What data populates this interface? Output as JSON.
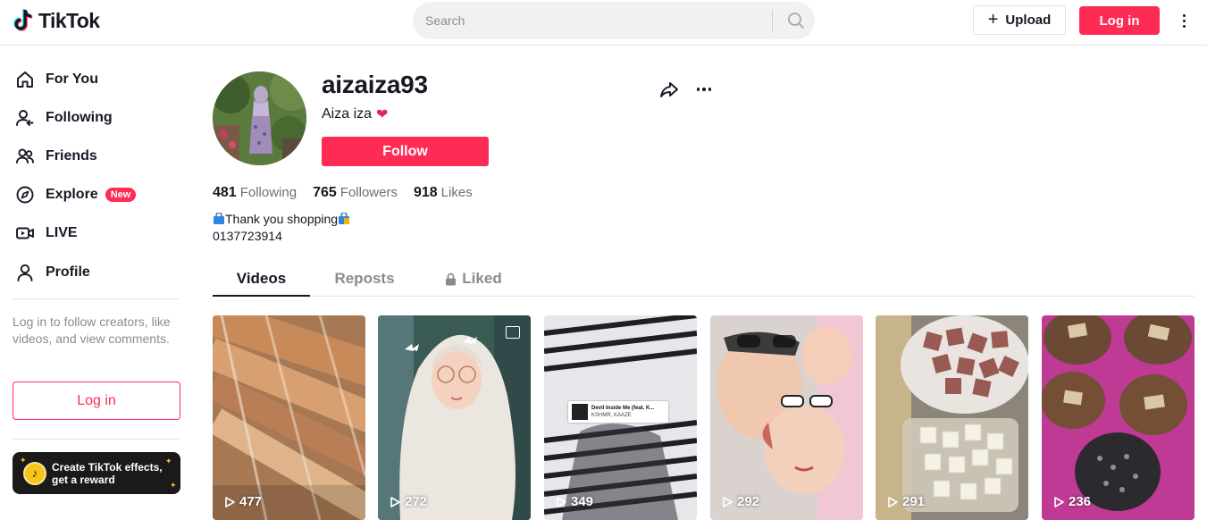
{
  "header": {
    "logo_text": "TikTok",
    "search_placeholder": "Search",
    "upload_label": "Upload",
    "login_label": "Log in"
  },
  "sidebar": {
    "items": [
      {
        "label": "For You",
        "icon": "home-icon"
      },
      {
        "label": "Following",
        "icon": "following-icon"
      },
      {
        "label": "Friends",
        "icon": "friends-icon"
      },
      {
        "label": "Explore",
        "icon": "compass-icon",
        "badge": "New"
      },
      {
        "label": "LIVE",
        "icon": "live-icon"
      },
      {
        "label": "Profile",
        "icon": "profile-icon"
      }
    ],
    "login_hint": "Log in to follow creators, like videos, and view comments.",
    "login_label": "Log in",
    "effects_banner": {
      "line1": "Create TikTok effects,",
      "line2": "get a reward"
    }
  },
  "profile": {
    "username": "aizaiza93",
    "nickname": "Aiza iza",
    "follow_label": "Follow",
    "stats": {
      "following": {
        "count": "481",
        "label": "Following"
      },
      "followers": {
        "count": "765",
        "label": "Followers"
      },
      "likes": {
        "count": "918",
        "label": "Likes"
      }
    },
    "bio_line1": "Thank you shopping",
    "bio_line2": "0137723914"
  },
  "tabs": [
    {
      "label": "Videos",
      "active": true
    },
    {
      "label": "Reposts",
      "active": false
    },
    {
      "label": "Liked",
      "active": false,
      "icon": "lock-icon"
    }
  ],
  "videos": [
    {
      "views": "477"
    },
    {
      "views": "272",
      "is_photo": true
    },
    {
      "views": "349",
      "music_title": "Devil Inside Me (feat. K...",
      "music_artist": "KSHMR, KAAZE"
    },
    {
      "views": "292"
    },
    {
      "views": "291"
    },
    {
      "views": "236"
    }
  ],
  "colors": {
    "brand": "#fe2c55",
    "text": "#161823",
    "muted": "#8a8b91"
  }
}
